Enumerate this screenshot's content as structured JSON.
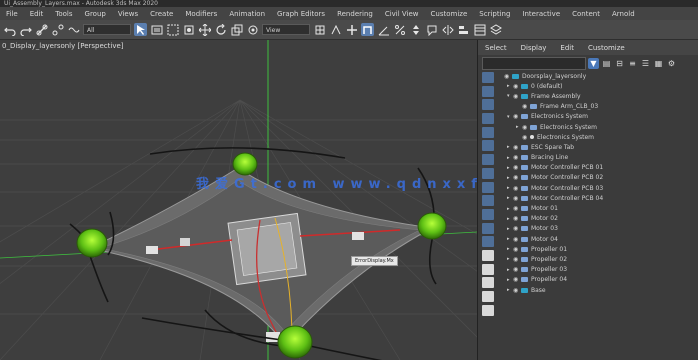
{
  "window": {
    "title": "Ui_Assembly_Layers.max - Autodesk 3ds Max 2020"
  },
  "menu": [
    "File",
    "Edit",
    "Tools",
    "Group",
    "Views",
    "Create",
    "Modifiers",
    "Animation",
    "Graph Editors",
    "Rendering",
    "Civil View",
    "Customize",
    "Scripting",
    "Interactive",
    "Content",
    "Arnold"
  ],
  "toolbar": {
    "selection_filter": "All",
    "view_reference": "View"
  },
  "viewport": {
    "label": "0_Display_layersonly [Perspective]",
    "watermark": "我爱Gt.com www.qdnxxfb.com",
    "tooltip": "ErrorDisplay.Mx"
  },
  "scene_explorer": {
    "tabs": [
      "Select",
      "Display",
      "Edit",
      "Customize"
    ],
    "rows": [
      {
        "label": "Doorsplay_layersonly",
        "indent": 0,
        "caret": "",
        "icon": "layer"
      },
      {
        "label": "0 (default)",
        "indent": 1,
        "caret": "▸",
        "icon": "layer"
      },
      {
        "label": "Frame Assembly",
        "indent": 1,
        "caret": "▾",
        "icon": "layer"
      },
      {
        "label": "Frame Arm_CLB_03",
        "indent": 2,
        "caret": "",
        "icon": "object"
      },
      {
        "label": "Electronics System",
        "indent": 1,
        "caret": "▾",
        "icon": "object"
      },
      {
        "label": "Electronics System",
        "indent": 2,
        "caret": "▸",
        "icon": "object"
      },
      {
        "label": "Electronics System",
        "indent": 2,
        "caret": "",
        "icon": "dot"
      },
      {
        "label": "ESC Spare Tab",
        "indent": 1,
        "caret": "▸",
        "icon": "object"
      },
      {
        "label": "Bracing Line",
        "indent": 1,
        "caret": "▸",
        "icon": "object"
      },
      {
        "label": "Motor Controller PCB 01",
        "indent": 1,
        "caret": "▸",
        "icon": "object"
      },
      {
        "label": "Motor Controller PCB 02",
        "indent": 1,
        "caret": "▸",
        "icon": "object"
      },
      {
        "label": "Motor Controller PCB 03",
        "indent": 1,
        "caret": "▸",
        "icon": "object"
      },
      {
        "label": "Motor Controller PCB 04",
        "indent": 1,
        "caret": "▸",
        "icon": "object"
      },
      {
        "label": "Motor 01",
        "indent": 1,
        "caret": "▸",
        "icon": "object"
      },
      {
        "label": "Motor 02",
        "indent": 1,
        "caret": "▸",
        "icon": "object"
      },
      {
        "label": "Motor 03",
        "indent": 1,
        "caret": "▸",
        "icon": "object"
      },
      {
        "label": "Motor 04",
        "indent": 1,
        "caret": "▸",
        "icon": "object"
      },
      {
        "label": "Propeller 01",
        "indent": 1,
        "caret": "▸",
        "icon": "object"
      },
      {
        "label": "Propeller 02",
        "indent": 1,
        "caret": "▸",
        "icon": "object"
      },
      {
        "label": "Propeller 03",
        "indent": 1,
        "caret": "▸",
        "icon": "object"
      },
      {
        "label": "Propeller 04",
        "indent": 1,
        "caret": "▸",
        "icon": "object"
      },
      {
        "label": "Base",
        "indent": 1,
        "caret": "▸",
        "icon": "layer"
      }
    ]
  }
}
